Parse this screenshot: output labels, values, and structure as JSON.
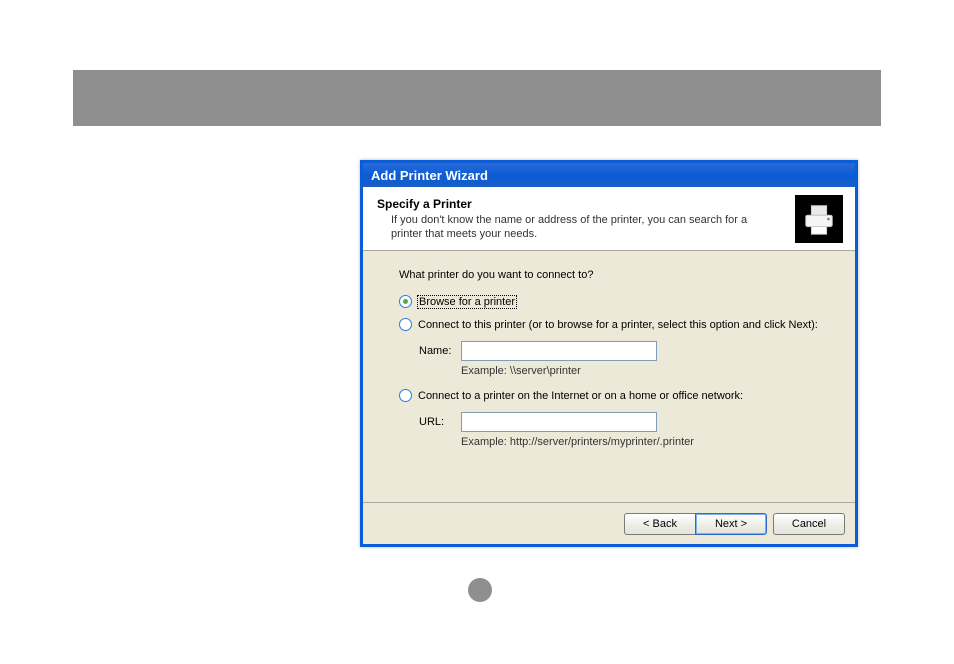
{
  "dialog": {
    "title": "Add Printer Wizard",
    "header_title": "Specify a Printer",
    "header_desc": "If you don't know the name or address of the printer, you can search for a printer that meets your needs."
  },
  "body": {
    "prompt": "What printer do you want to connect to?",
    "option_browse": "Browse for a printer",
    "option_connect": "Connect to this printer (or to browse for a printer, select this option and click Next):",
    "name_label": "Name:",
    "name_value": "",
    "name_example": "Example: \\\\server\\printer",
    "option_internet": "Connect to a printer on the Internet or on a home or office network:",
    "url_label": "URL:",
    "url_value": "",
    "url_example": "Example: http://server/printers/myprinter/.printer"
  },
  "buttons": {
    "back": "< Back",
    "next": "Next >",
    "cancel": "Cancel"
  }
}
